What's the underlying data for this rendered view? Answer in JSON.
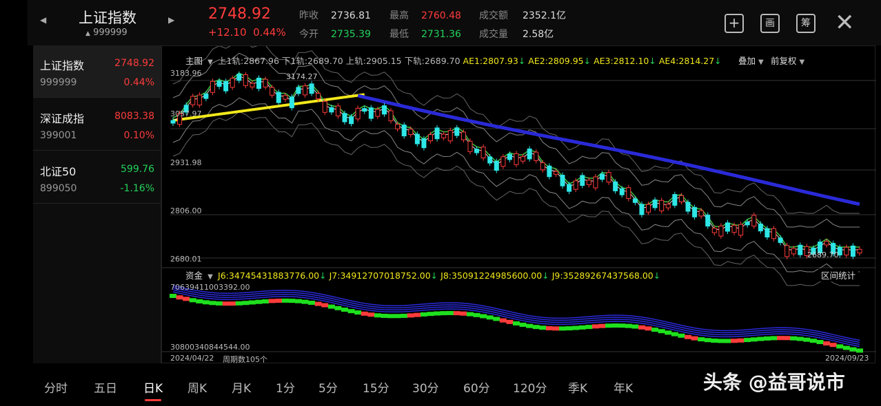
{
  "header": {
    "title": "上证指数",
    "code": "999999",
    "price": "2748.92",
    "change": "+12.10",
    "change_pct": "0.44%",
    "quotes": [
      {
        "label": "昨收",
        "value": "2736.81",
        "color": "grey"
      },
      {
        "label": "今开",
        "value": "2735.39",
        "color": "green"
      },
      {
        "label": "最高",
        "value": "2760.48",
        "color": "red"
      },
      {
        "label": "最低",
        "value": "2731.36",
        "color": "green"
      },
      {
        "label": "成交额",
        "value": "2352.1亿",
        "color": "grey"
      },
      {
        "label": "成交量",
        "value": "2.58亿",
        "color": "grey"
      }
    ],
    "tools": [
      "+",
      "画",
      "筹"
    ]
  },
  "sidebar": {
    "items": [
      {
        "name": "上证指数",
        "price": "2748.92",
        "code": "999999",
        "pct": "0.44%",
        "color": "red"
      },
      {
        "name": "深证成指",
        "price": "8083.38",
        "code": "399001",
        "pct": "0.10%",
        "color": "red"
      },
      {
        "name": "北证50",
        "price": "599.76",
        "code": "899050",
        "pct": "-1.16%",
        "color": "green"
      }
    ]
  },
  "main_panel": {
    "label": "主图",
    "legend": [
      "上1轨:2867.96",
      "下1轨:2689.70",
      "上轨:2905.15",
      "下轨:2689.70"
    ],
    "ae": [
      "AE1:2807.93",
      "AE2:2809.95",
      "AE3:2812.10",
      "AE4:2814.27"
    ],
    "overlay_label": "叠加",
    "adjust_label": "前复权",
    "y_labels": [
      "3183.96",
      "3057.97",
      "2931.98",
      "2806.00",
      "2680.01"
    ],
    "high_label": "3174.27",
    "low_label": "2689.70"
  },
  "fund_panel": {
    "label": "资金",
    "legend": [
      "J6:34745431883776.00",
      "J7:34912707018752.00",
      "J8:35091224985600.00",
      "J9:35289267437568.00"
    ],
    "stats_label": "区间统计",
    "y_top": "70639411003392.00",
    "y_bottom": "30800340844544.00"
  },
  "footer": {
    "start_date": "2024/04/22",
    "period_count": "周期数105个",
    "end_date": "2024/09/23"
  },
  "tabs": [
    "分时",
    "五日",
    "日K",
    "周K",
    "月K",
    "1分",
    "5分",
    "15分",
    "30分",
    "60分",
    "120分",
    "季K",
    "年K"
  ],
  "active_tab": "日K",
  "watermark": "头条 @益哥说市",
  "colors": {
    "up": "#ff3b3b",
    "down": "#22d35a",
    "bg": "#000000",
    "ma_yellow": "#f2e81b",
    "ma_blue": "#2a2ad8"
  }
}
